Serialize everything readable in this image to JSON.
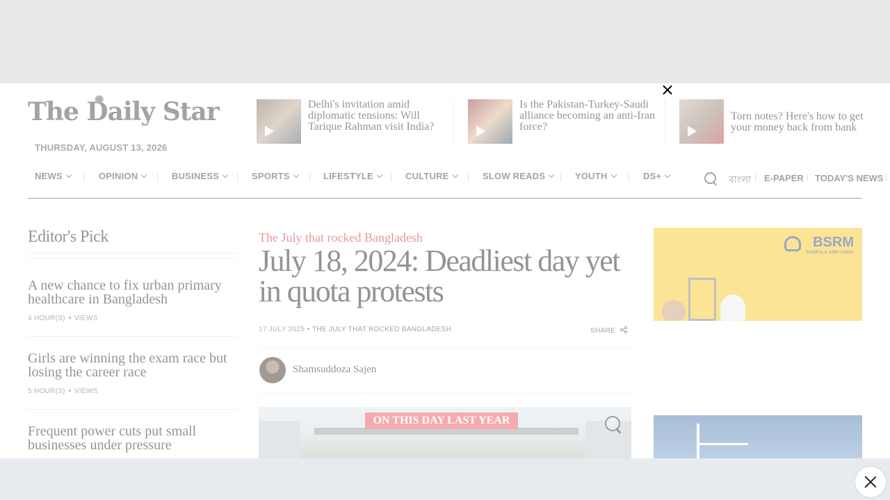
{
  "site": {
    "logo_text": "The Daily Star",
    "date": "THURSDAY, AUGUST 13, 2026"
  },
  "teasers": [
    {
      "title": "Delhi's invitation amid diplomatic tensions: Will Tarique Rahman visit India?",
      "icon": "play-icon"
    },
    {
      "title": "Is the Pakistan-Turkey-Saudi alliance becoming an anti-Iran force?",
      "icon": "play-icon"
    },
    {
      "title": "Torn notes? Here's how to get your money back from bank",
      "icon": "play-icon"
    }
  ],
  "nav": {
    "items": [
      {
        "label": "NEWS"
      },
      {
        "label": "OPINION"
      },
      {
        "label": "BUSINESS"
      },
      {
        "label": "SPORTS"
      },
      {
        "label": "LIFESTYLE"
      },
      {
        "label": "CULTURE"
      },
      {
        "label": "SLOW READS"
      },
      {
        "label": "YOUTH"
      },
      {
        "label": "DS+"
      }
    ],
    "bangla": "বাংলা",
    "epaper": "E-PAPER",
    "todays_news": "TODAY'S NEWS"
  },
  "editors_pick": {
    "title": "Editor's Pick",
    "items": [
      {
        "headline": "A new chance to fix urban primary healthcare in Bangladesh",
        "time": "4 HOUR(S)",
        "views": "VIEWS"
      },
      {
        "headline": "Girls are winning the exam race but losing the career race",
        "time": "5 HOUR(S)",
        "views": "VIEWS"
      },
      {
        "headline": "Frequent power cuts put small businesses under pressure"
      }
    ]
  },
  "article": {
    "kicker": "The July that rocked Bangladesh",
    "headline": "July 18, 2024: Deadliest day yet in quota protests",
    "date": "17 JULY 2025",
    "section": "THE JULY THAT ROCKED BANGLADESH",
    "share": "SHARE",
    "author": "Shamsuddoza Sajen",
    "hero_banner": "ON THIS DAY LAST YEAR"
  },
  "ads": {
    "brand": "BSRM",
    "tagline": "building a safer nation"
  },
  "colors": {
    "kicker": "#c41b22",
    "ad_yellow": "#f7c414",
    "ad_blue": "#1c3e7d",
    "banner_red": "#e8434b"
  }
}
